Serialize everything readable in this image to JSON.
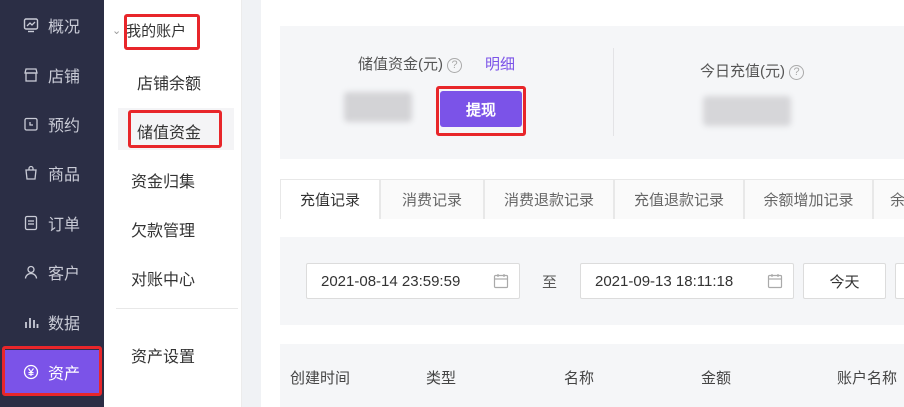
{
  "nav": {
    "items": [
      {
        "label": "概况",
        "icon": "monitor-icon"
      },
      {
        "label": "店铺",
        "icon": "store-icon"
      },
      {
        "label": "预约",
        "icon": "calendar-clock-icon"
      },
      {
        "label": "商品",
        "icon": "bag-icon"
      },
      {
        "label": "订单",
        "icon": "list-icon"
      },
      {
        "label": "客户",
        "icon": "user-icon"
      },
      {
        "label": "数据",
        "icon": "bar-chart-icon"
      },
      {
        "label": "资产",
        "icon": "yuan-icon"
      }
    ],
    "active_index": 7,
    "accent": "#7b53e8"
  },
  "submenu": {
    "group_title": "我的账户",
    "items": [
      "店铺余额",
      "储值资金",
      "资金归集",
      "欠款管理",
      "对账中心",
      "资产设置"
    ],
    "selected": "储值资金"
  },
  "summary": {
    "stored_label": "储值资金(元)",
    "detail_link": "明细",
    "withdraw_button": "提现",
    "today_label": "今日充值(元)"
  },
  "tabs": [
    "充值记录",
    "消费记录",
    "消费退款记录",
    "充值退款记录",
    "余额增加记录",
    "余"
  ],
  "filter": {
    "start_date": "2021-08-14 23:59:59",
    "to_label": "至",
    "end_date": "2021-09-13 18:11:18",
    "today_button": "今天"
  },
  "table": {
    "headers": [
      "创建时间",
      "类型",
      "名称",
      "金额",
      "账户名称"
    ]
  }
}
